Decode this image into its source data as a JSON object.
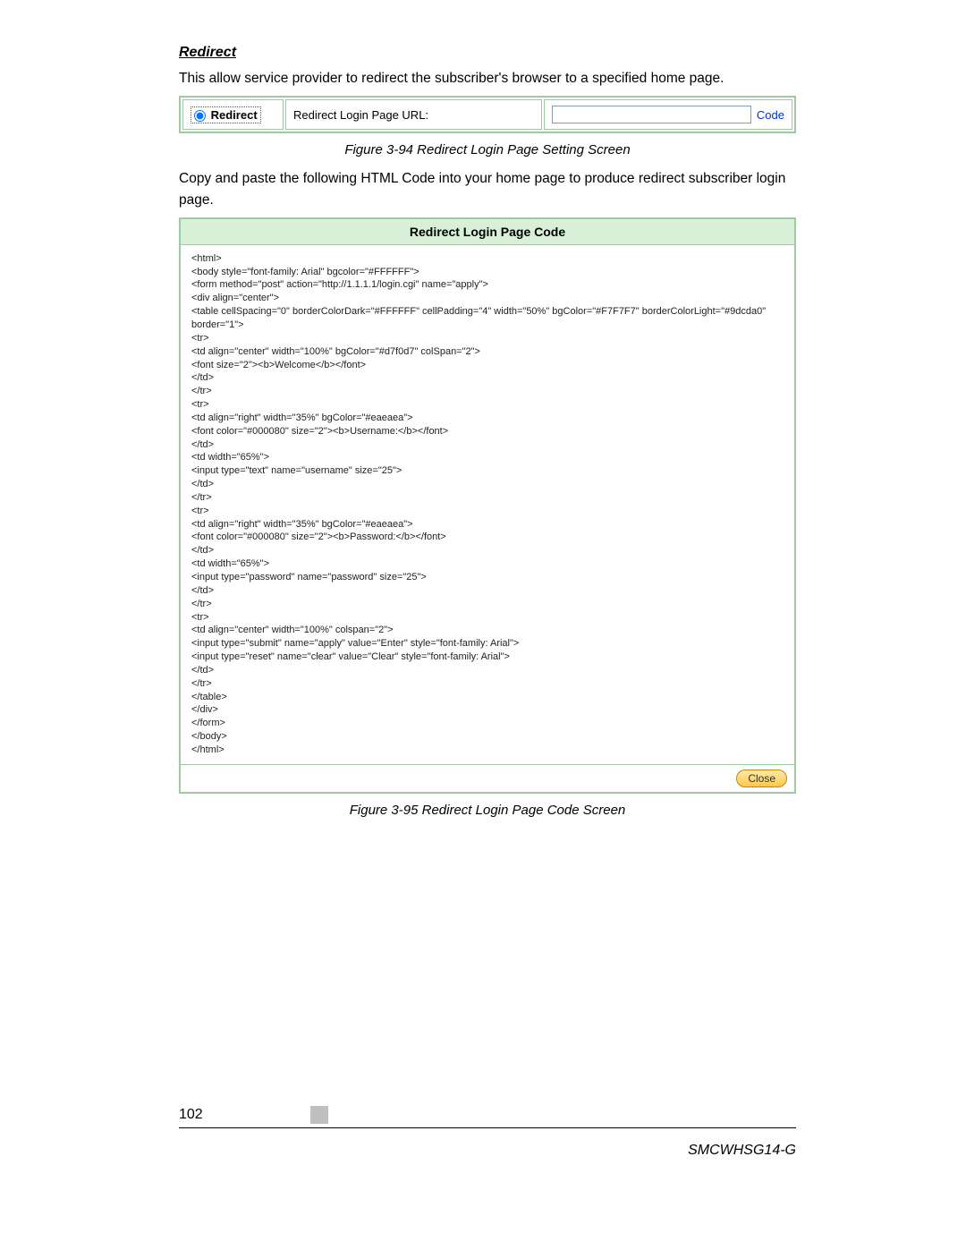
{
  "section_heading": "Redirect",
  "intro_text": "This allow service provider to redirect the subscriber's browser to a specified home page.",
  "redirect_row": {
    "radio_label": "Redirect",
    "url_label": "Redirect Login Page URL:",
    "code_link": "Code"
  },
  "figure94_caption": "Figure 3-94 Redirect Login Page Setting Screen",
  "copy_paste_text": "Copy and paste the following HTML Code into your home page to produce redirect subscriber login page.",
  "code_header": "Redirect Login Page Code",
  "code_body": "<html>\n<body style=\"font-family: Arial\" bgcolor=\"#FFFFFF\">\n<form method=\"post\" action=\"http://1.1.1.1/login.cgi\" name=\"apply\">\n<div align=\"center\">\n<table cellSpacing=\"0\" borderColorDark=\"#FFFFFF\" cellPadding=\"4\" width=\"50%\" bgColor=\"#F7F7F7\" borderColorLight=\"#9dcda0\" border=\"1\">\n<tr>\n<td align=\"center\" width=\"100%\" bgColor=\"#d7f0d7\" colSpan=\"2\">\n<font size=\"2\"><b>Welcome</b></font>\n</td>\n</tr>\n<tr>\n<td align=\"right\" width=\"35%\" bgColor=\"#eaeaea\">\n<font color=\"#000080\" size=\"2\"><b>Username:</b></font>\n</td>\n<td width=\"65%\">\n<input type=\"text\" name=\"username\" size=\"25\">\n</td>\n</tr>\n<tr>\n<td align=\"right\" width=\"35%\" bgColor=\"#eaeaea\">\n<font color=\"#000080\" size=\"2\"><b>Password:</b></font>\n</td>\n<td width=\"65%\">\n<input type=\"password\" name=\"password\" size=\"25\">\n</td>\n</tr>\n<tr>\n<td align=\"center\" width=\"100%\" colspan=\"2\">\n<input type=\"submit\" name=\"apply\" value=\"Enter\" style=\"font-family: Arial\">\n<input type=\"reset\" name=\"clear\" value=\"Clear\" style=\"font-family: Arial\">\n</td>\n</tr>\n</table>\n</div>\n</form>\n</body>\n</html>",
  "close_label": "Close",
  "figure95_caption": "Figure 3-95 Redirect Login Page Code Screen",
  "page_number": "102",
  "model": "SMCWHSG14-G"
}
